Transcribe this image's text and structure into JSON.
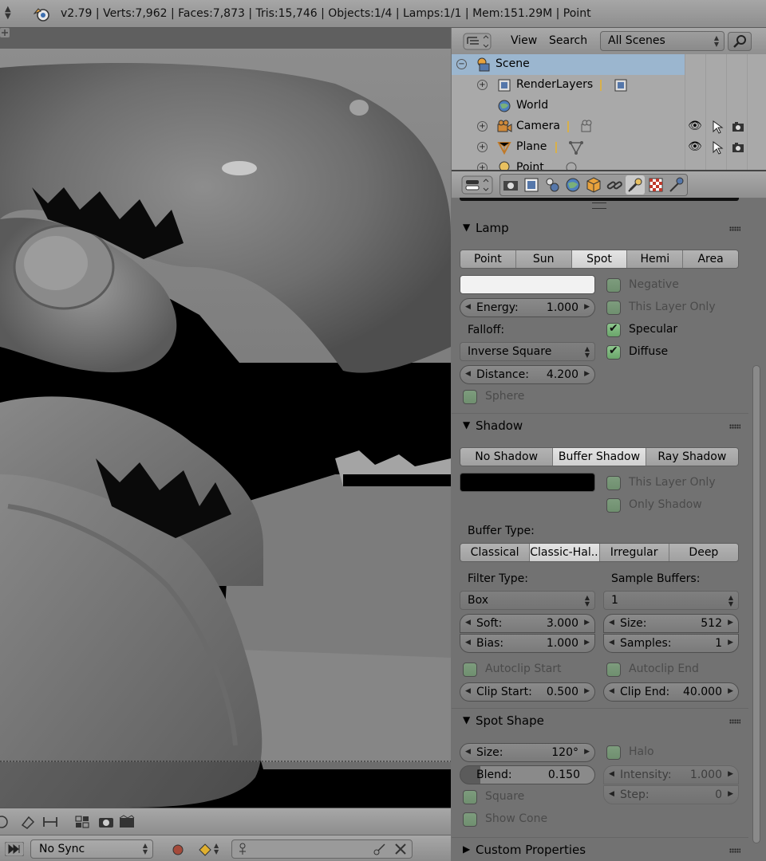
{
  "infobar": {
    "stats": "v2.79 | Verts:7,962 | Faces:7,873 | Tris:15,746 | Objects:1/4 | Lamps:1/1 | Mem:151.29M | Point"
  },
  "timeline": {
    "sync": "No Sync"
  },
  "outliner": {
    "menu_view": "View",
    "menu_search": "Search",
    "scene_filter": "All Scenes",
    "rows": [
      {
        "label": "Scene"
      },
      {
        "label": "RenderLayers"
      },
      {
        "label": "World"
      },
      {
        "label": "Camera"
      },
      {
        "label": "Plane"
      },
      {
        "label": "Point"
      }
    ]
  },
  "lamp": {
    "title": "Lamp",
    "types": [
      "Point",
      "Sun",
      "Spot",
      "Hemi",
      "Area"
    ],
    "active_type": "Spot",
    "negative": "Negative",
    "this_layer_only": "This Layer Only",
    "specular": "Specular",
    "diffuse": "Diffuse",
    "energy_label": "Energy:",
    "energy_value": "1.000",
    "falloff_label": "Falloff:",
    "falloff_value": "Inverse Square",
    "distance_label": "Distance:",
    "distance_value": "4.200",
    "sphere": "Sphere",
    "color": "#f2f2f2"
  },
  "shadow": {
    "title": "Shadow",
    "modes": [
      "No Shadow",
      "Buffer Shadow",
      "Ray Shadow"
    ],
    "active_mode": "Buffer Shadow",
    "this_layer_only": "This Layer Only",
    "only_shadow": "Only Shadow",
    "buffer_type_label": "Buffer Type:",
    "buffer_types": [
      "Classical",
      "Classic-Hal...",
      "Irregular",
      "Deep"
    ],
    "active_buffer": "Classic-Hal...",
    "filter_type_label": "Filter Type:",
    "filter_type_value": "Box",
    "sample_buffers_label": "Sample Buffers:",
    "sample_buffers_value": "1",
    "soft_label": "Soft:",
    "soft_value": "3.000",
    "bias_label": "Bias:",
    "bias_value": "1.000",
    "size_label": "Size:",
    "size_value": "512",
    "samples_label": "Samples:",
    "samples_value": "1",
    "autoclip_start": "Autoclip Start",
    "autoclip_end": "Autoclip End",
    "clip_start_label": "Clip Start:",
    "clip_start_value": "0.500",
    "clip_end_label": "Clip End:",
    "clip_end_value": "40.000",
    "color": "#000000"
  },
  "spot": {
    "title": "Spot Shape",
    "size_label": "Size:",
    "size_value": "120°",
    "blend_label": "Blend:",
    "blend_value": "0.150",
    "halo": "Halo",
    "intensity_label": "Intensity:",
    "intensity_value": "1.000",
    "step_label": "Step:",
    "step_value": "0",
    "square": "Square",
    "show_cone": "Show Cone"
  },
  "custom": {
    "title": "Custom Properties"
  }
}
